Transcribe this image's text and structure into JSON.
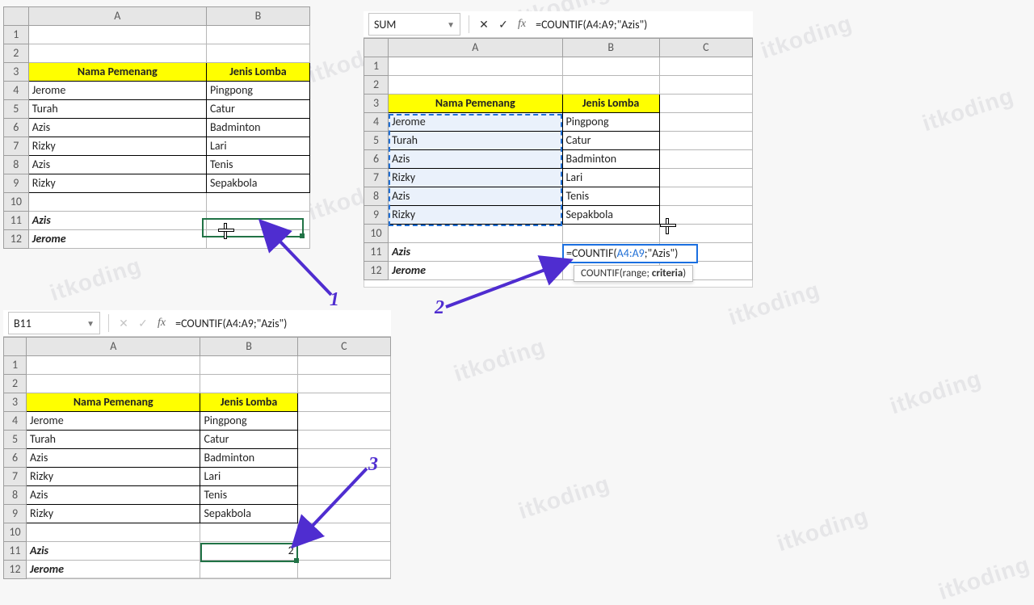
{
  "watermark": "itkoding",
  "formula": "=COUNTIF(A4:A9;\"Azis\")",
  "formula_edit_pre": "=COUNTIF(",
  "formula_edit_rng": "A4:A9",
  "formula_edit_post": ";\"Azis\")",
  "tooltip_pre": "COUNTIF(range; ",
  "tooltip_bold": "criteria",
  "tooltip_post": ")",
  "headers": {
    "name": "Nama Pemenang",
    "type": "Jenis Lomba"
  },
  "rows": [
    {
      "name": "Jerome",
      "type": "Pingpong"
    },
    {
      "name": "Turah",
      "type": "Catur"
    },
    {
      "name": "Azis",
      "type": "Badminton"
    },
    {
      "name": "Rizky",
      "type": "Lari"
    },
    {
      "name": "Azis",
      "type": "Tenis"
    },
    {
      "name": "Rizky",
      "type": "Sepakbola"
    }
  ],
  "query_rows": [
    {
      "name": "Azis"
    },
    {
      "name": "Jerome"
    }
  ],
  "result_value": "2",
  "panel1": {
    "cols": [
      "A",
      "B"
    ],
    "namebox": ""
  },
  "panel2": {
    "cols": [
      "A",
      "B",
      "C"
    ],
    "namebox": "SUM"
  },
  "panel3": {
    "cols": [
      "A",
      "B",
      "C"
    ],
    "namebox": "B11"
  },
  "annotations": {
    "1": "1",
    "2": "2",
    "3": "3"
  },
  "chart_data": null
}
